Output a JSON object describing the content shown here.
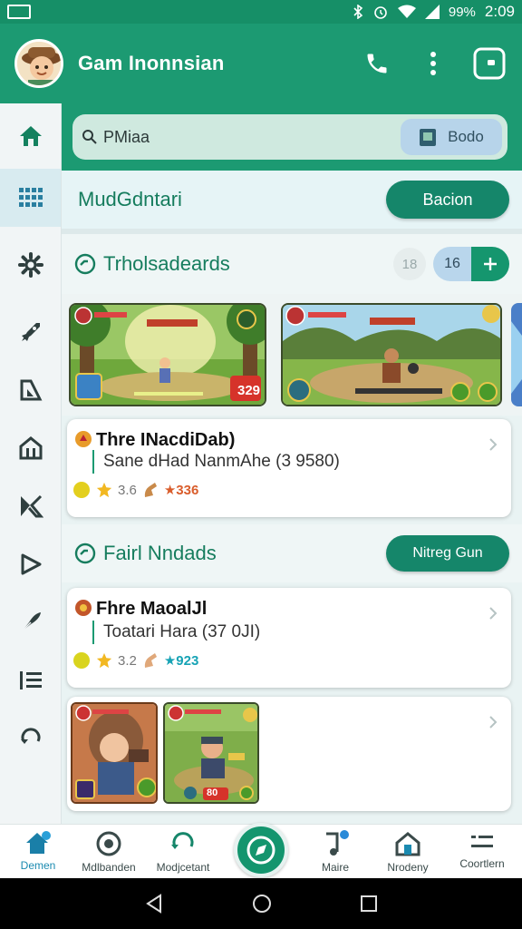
{
  "status_bar": {
    "battery": "99%",
    "time": "2:09"
  },
  "app_bar": {
    "title": "Gam Inonnsian"
  },
  "search": {
    "placeholder": "PMiaa",
    "chip_label": "Bodo"
  },
  "mode_row": {
    "label": "MudGdntari",
    "button": "Bacion"
  },
  "section_1": {
    "title": "Trholsadeards",
    "faded_count": "18",
    "count": "16"
  },
  "thumbnails_1": [
    {
      "name": "forest-battle",
      "score": "329"
    },
    {
      "name": "jungle-hunter"
    }
  ],
  "card_1": {
    "title": "Thre INacdiDab)",
    "subtitle": "Sane dHad NanmAhe (3 9580)",
    "rating": "3.6",
    "price": "★336"
  },
  "section_2": {
    "title": "Fairl Nndads",
    "button": "Nitreg Gun"
  },
  "card_2": {
    "title": "Fhre MaoalJl",
    "subtitle": "Toatari Hara (37 0JI)",
    "rating": "3.2",
    "price": "★923"
  },
  "thumbnails_2": [
    {
      "name": "warrior-girl"
    },
    {
      "name": "miner-hero",
      "score": "80"
    }
  ],
  "bottom_nav": [
    {
      "label": "Demen",
      "icon": "home-icon"
    },
    {
      "label": "Mdlbanden",
      "icon": "disc-icon"
    },
    {
      "label": "Modjcetant",
      "icon": "refresh-icon"
    },
    {
      "label": "Maire",
      "icon": "music-icon"
    },
    {
      "label": "Nrodeny",
      "icon": "store-icon"
    },
    {
      "label": "Coortlern",
      "icon": "menu-icon"
    }
  ],
  "colors": {
    "primary": "#1c9a72",
    "accent": "#15866a",
    "active_blue": "#1a8ab0"
  }
}
